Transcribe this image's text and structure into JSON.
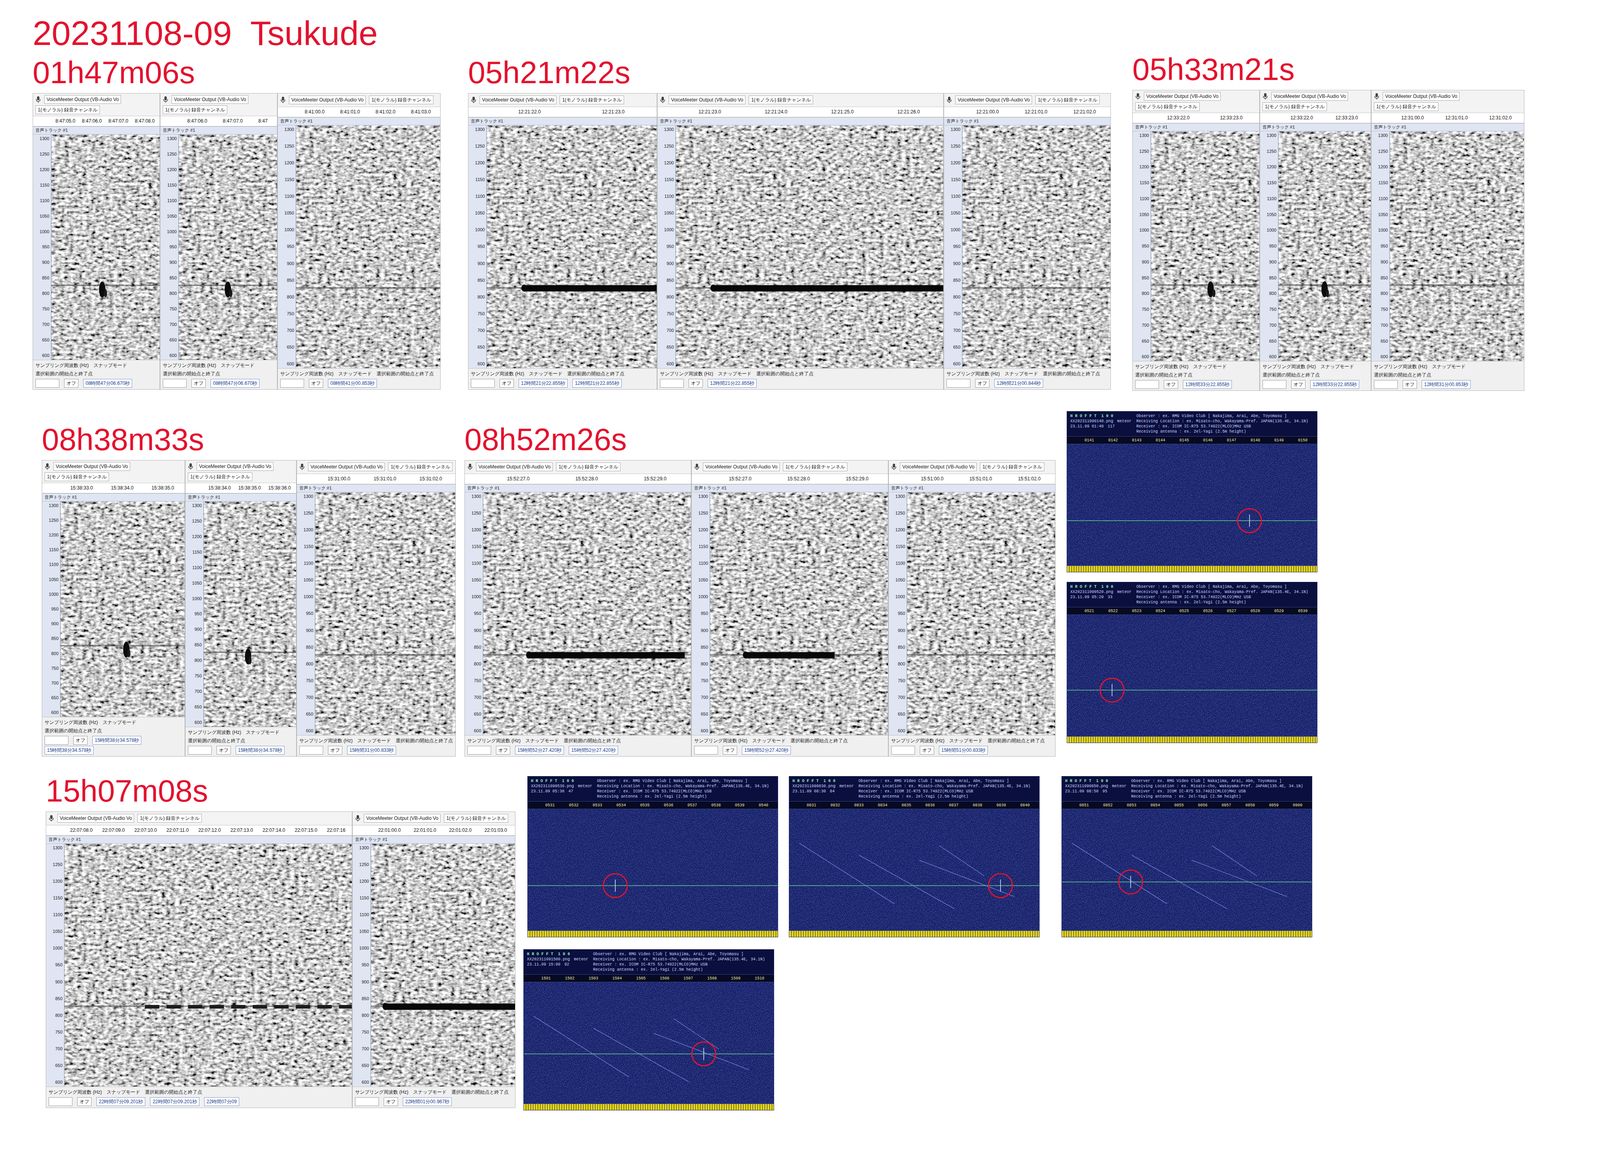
{
  "title": "20231108-09  Tsukude",
  "audacity": {
    "device": "VoiceMeeter Output (VB-Audio Vo",
    "channels": "1(モノラル) 録音チャンネル",
    "track": "音声トラック #1",
    "rate_label": "サンプリング周波数 (Hz)",
    "snap_label": "スナップモード",
    "selection_label": "選択範囲の開始点と終了点",
    "snap_value": "オフ",
    "freq_ticks": [
      "1300",
      "1250",
      "1200",
      "1150",
      "1100",
      "1050",
      "1000",
      "950",
      "900",
      "850",
      "800",
      "750",
      "700",
      "650",
      "600"
    ]
  },
  "events": [
    {
      "label": "01h47m06s",
      "panels": [
        {
          "ticks": [
            "8:47:05.0",
            "8:47:06.0",
            "8:47:07.0",
            "8:47:08.0"
          ],
          "readouts": [
            "08時間47分06.670秒"
          ],
          "echo": {
            "kind": "blob",
            "start": 0.47,
            "end": 0.5
          }
        },
        {
          "ticks": [
            "8:47:06.0",
            "8:47:07.0",
            "8:47"
          ],
          "readouts": [
            "08時間47分06.670秒"
          ],
          "echo": {
            "kind": "blob",
            "start": 0.5,
            "end": 0.53
          }
        },
        {
          "ticks": [
            "8:41:00.0",
            "8:41:01.0",
            "8:41:02.0",
            "8:41:03.0"
          ],
          "readouts": [
            "08時間41分00.853秒"
          ],
          "echo": {
            "kind": "none",
            "start": 0,
            "end": 0
          }
        }
      ]
    },
    {
      "label": "05h21m22s",
      "panels": [
        {
          "ticks": [
            "12:21:22.0",
            "12:21:23.0"
          ],
          "readouts": [
            "12時間21分22.855秒",
            "12時間21分22.855秒"
          ],
          "echo": {
            "kind": "trail",
            "start": 0.22,
            "end": 1.0
          }
        },
        {
          "ticks": [
            "12:21:23.0",
            "12:21:24.0",
            "12:21:25.0",
            "12:21:26.0"
          ],
          "readouts": [
            "12時間21分22.855秒"
          ],
          "echo": {
            "kind": "trail",
            "start": 0.14,
            "end": 1.0
          }
        },
        {
          "ticks": [
            "12:21:00.0",
            "12:21:01.0",
            "12:21:02.0"
          ],
          "readouts": [
            "12時間21分00.844秒"
          ],
          "echo": {
            "kind": "none",
            "start": 0,
            "end": 0
          }
        }
      ]
    },
    {
      "label": "05h33m21s",
      "panels": [
        {
          "ticks": [
            "12:33:22.0",
            "12:33:23.0"
          ],
          "readouts": [
            "12時間33分22.855秒"
          ],
          "echo": {
            "kind": "blob",
            "start": 0.55,
            "end": 0.58
          }
        },
        {
          "ticks": [
            "12:33:22.0",
            "12:33:23.0"
          ],
          "readouts": [
            "12時間33分22.855秒"
          ],
          "echo": {
            "kind": "blob",
            "start": 0.5,
            "end": 0.53
          }
        },
        {
          "ticks": [
            "12:31:00.0",
            "12:31:01.0",
            "12:31:02.0"
          ],
          "readouts": [
            "12時間31分00.853秒"
          ],
          "echo": {
            "kind": "none",
            "start": 0,
            "end": 0
          }
        }
      ]
    },
    {
      "label": "08h38m33s",
      "panels": [
        {
          "ticks": [
            "15:38:33.0",
            "15:38:34.0",
            "15:38:35.0"
          ],
          "readouts": [
            "15時間38分34.578秒",
            "15時間38分34.578秒"
          ],
          "echo": {
            "kind": "blob",
            "start": 0.53,
            "end": 0.55
          }
        },
        {
          "ticks": [
            "15:38:34.0",
            "15:38:35.0",
            "15:38:36.0"
          ],
          "readouts": [
            "15時間38分34.578秒"
          ],
          "echo": {
            "kind": "blob",
            "start": 0.48,
            "end": 0.5
          }
        },
        {
          "ticks": [
            "15:31:00.0",
            "15:31:01.0",
            "15:31:02.0"
          ],
          "readouts": [
            "15時間31分00.833秒"
          ],
          "echo": {
            "kind": "none",
            "start": 0,
            "end": 0
          }
        }
      ]
    },
    {
      "label": "08h52m26s",
      "panels": [
        {
          "ticks": [
            "15:52:27.0",
            "15:52:28.0",
            "15:52:29.0"
          ],
          "readouts": [
            "15時間52分27.420秒",
            "15時間52分27.420秒"
          ],
          "echo": {
            "kind": "trail",
            "start": 0.22,
            "end": 0.97
          }
        },
        {
          "ticks": [
            "15:52:27.0",
            "15:52:28.0",
            "15:52:29.0"
          ],
          "readouts": [
            "15時間52分27.420秒"
          ],
          "echo": {
            "kind": "trail",
            "start": 0.2,
            "end": 0.7
          }
        },
        {
          "ticks": [
            "15:51:00.0",
            "15:51:01.0",
            "15:51:02.0"
          ],
          "readouts": [
            "15時間51分00.833秒"
          ],
          "echo": {
            "kind": "none",
            "start": 0,
            "end": 0
          }
        }
      ]
    },
    {
      "label": "15h07m08s",
      "panels": [
        {
          "ticks": [
            "22:07:08.0",
            "22:07:09.0",
            "22:07:10.0",
            "22:07:11.0",
            "22:07:12.0",
            "22:07:13.0",
            "22:07:14.0",
            "22:07:15.0",
            "22:07:16"
          ],
          "readouts": [
            "22時間07分09.201秒",
            "22時間07分09.201秒",
            "22時間07分09"
          ],
          "echo": {
            "kind": "dashes",
            "start": 0.28,
            "end": 1.0
          }
        },
        {
          "ticks": [
            "22:01:00.0",
            "22:01:01.0",
            "22:01:02.0",
            "22:01:03.0"
          ],
          "readouts": [
            "22時間01分00.967秒"
          ],
          "echo": {
            "kind": "trail",
            "start": 0.1,
            "end": 1.0
          }
        }
      ]
    }
  ],
  "hrofft_info": {
    "name": "H R O F F T  1 0 0",
    "meteor_label": "meteor",
    "observer": "Observer : ex. RMG Video Club [ Nakajima, Arai, Abe, Toyomasu ]",
    "location": "Receiving Location : ex. Misato-cho, Wakayama-Pref. JAPAN(135.4E, 34.1N)",
    "receiver": "Receiver : ex. ICOM IC-R75 53.74922(MLCO)MHz USB",
    "antenna": "Receiving antenna : ex. 2el-Yagi (2.5m height)"
  },
  "hrofft": [
    {
      "file": "XX202311090140.png",
      "stamp": "23.11.09 01:40",
      "count": "117",
      "ticks": [
        "0141",
        "0142",
        "0143",
        "0144",
        "0145",
        "0146",
        "0147",
        "0148",
        "0149",
        "0150"
      ],
      "event": {
        "time": 0.73,
        "freq": 0.63
      },
      "interference": false
    },
    {
      "file": "XX202311090520.png",
      "stamp": "23.11.09 05:20",
      "count": "33",
      "ticks": [
        "0521",
        "0522",
        "0523",
        "0524",
        "0525",
        "0526",
        "0527",
        "0528",
        "0529",
        "0530"
      ],
      "event": {
        "time": 0.18,
        "freq": 0.62
      },
      "interference": false
    },
    {
      "file": "XX202311090530.png",
      "stamp": "23.11.09 05:30",
      "count": "47",
      "ticks": [
        "0531",
        "0532",
        "0533",
        "0534",
        "0535",
        "0536",
        "0537",
        "0538",
        "0539",
        "0540"
      ],
      "event": {
        "time": 0.35,
        "freq": 0.63
      },
      "interference": false
    },
    {
      "file": "XX202311090830.png",
      "stamp": "23.11.09 08:30",
      "count": "84",
      "ticks": [
        "0831",
        "0832",
        "0833",
        "0834",
        "0835",
        "0836",
        "0837",
        "0838",
        "0839",
        "0840"
      ],
      "event": {
        "time": 0.845,
        "freq": 0.63
      },
      "interference": true
    },
    {
      "file": "XX202311090850.png",
      "stamp": "23.11.09 08:50",
      "count": "95",
      "ticks": [
        "0851",
        "0852",
        "0853",
        "0854",
        "0855",
        "0856",
        "0857",
        "0858",
        "0859",
        "0900"
      ],
      "event": {
        "time": 0.275,
        "freq": 0.6
      },
      "interference": true
    },
    {
      "file": "XX202311091500.png",
      "stamp": "23.11.09 15:00",
      "count": "92",
      "ticks": [
        "1501",
        "1502",
        "1503",
        "1504",
        "1505",
        "1506",
        "1507",
        "1508",
        "1509",
        "1510"
      ],
      "event": {
        "time": 0.72,
        "freq": 0.59
      },
      "interference": true
    }
  ]
}
